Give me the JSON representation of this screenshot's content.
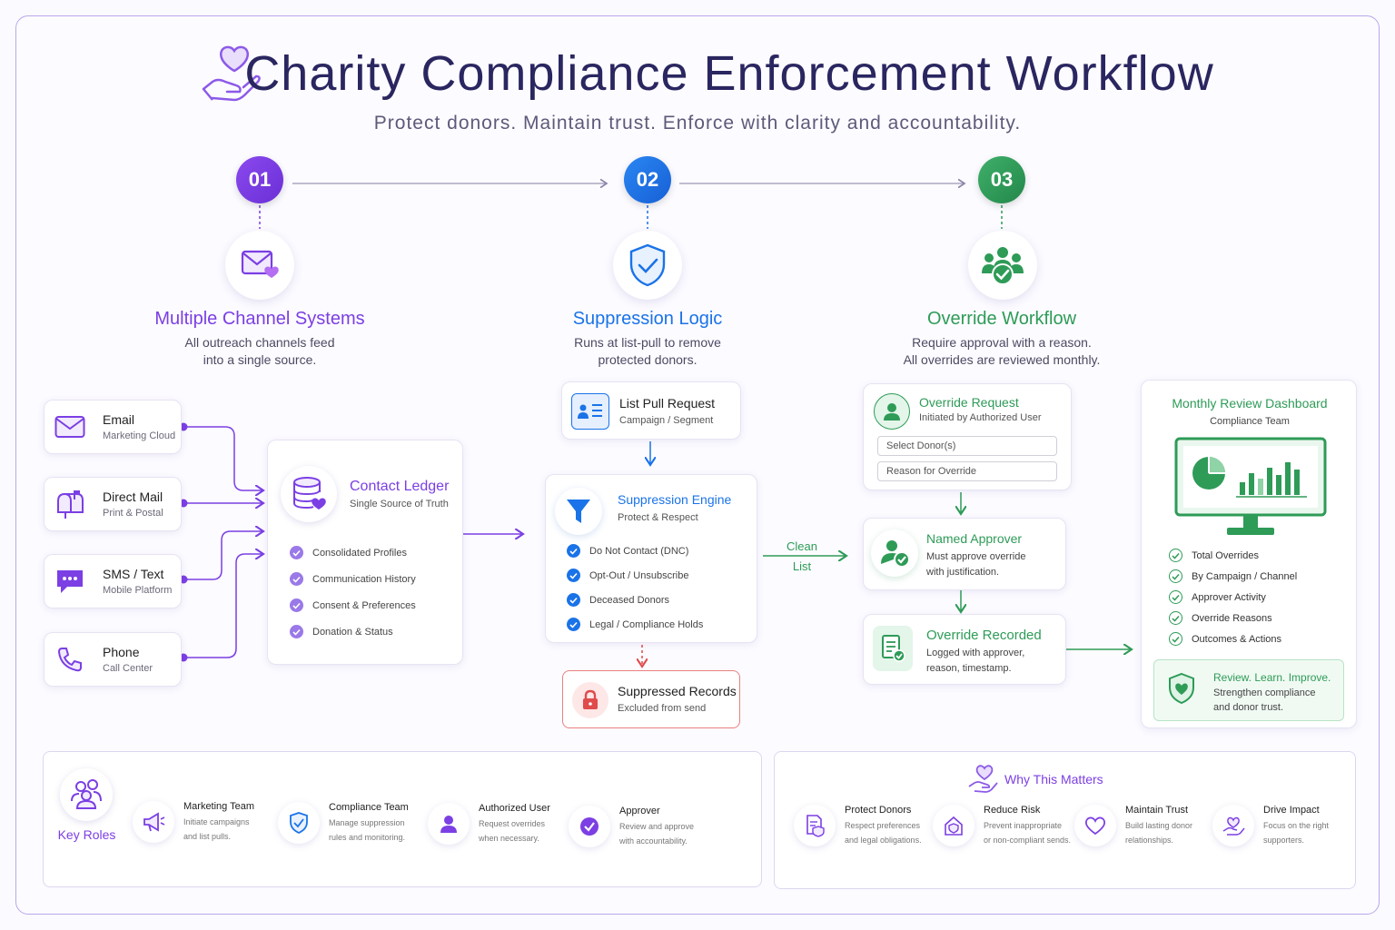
{
  "header": {
    "title": "Charity Compliance Enforcement Workflow",
    "subtitle": "Protect donors. Maintain trust. Enforce with clarity and accountability."
  },
  "colors": {
    "purple": "#7b3fe4",
    "blue": "#1a73e8",
    "green": "#2e9b57",
    "red": "#e04b4b"
  },
  "steps": [
    {
      "num": "01",
      "title": "Multiple Channel Systems",
      "desc_line1": "All outreach channels feed",
      "desc_line2": "into a single source.",
      "icon": "mail-heart-icon"
    },
    {
      "num": "02",
      "title": "Suppression Logic",
      "desc_line1": "Runs at list-pull to remove",
      "desc_line2": "protected donors.",
      "icon": "shield-check-icon"
    },
    {
      "num": "03",
      "title": "Override Workflow",
      "desc_line1": "Require approval with a reason.",
      "desc_line2": "All overrides are reviewed monthly.",
      "icon": "team-check-icon"
    }
  ],
  "channels": [
    {
      "title": "Email",
      "sub": "Marketing Cloud",
      "icon": "envelope-icon"
    },
    {
      "title": "Direct Mail",
      "sub": "Print & Postal",
      "icon": "mailbox-icon"
    },
    {
      "title": "SMS / Text",
      "sub": "Mobile Platform",
      "icon": "chat-icon"
    },
    {
      "title": "Phone",
      "sub": "Call Center",
      "icon": "phone-icon"
    }
  ],
  "ledger": {
    "title": "Contact Ledger",
    "sub": "Single Source of Truth",
    "items": [
      "Consolidated Profiles",
      "Communication History",
      "Consent & Preferences",
      "Donation & Status"
    ]
  },
  "list_pull": {
    "title": "List Pull Request",
    "sub": "Campaign / Segment"
  },
  "engine": {
    "title": "Suppression Engine",
    "sub": "Protect & Respect",
    "items": [
      "Do Not Contact (DNC)",
      "Opt-Out / Unsubscribe",
      "Deceased Donors",
      "Legal / Compliance Holds"
    ]
  },
  "suppressed": {
    "title": "Suppressed Records",
    "sub": "Excluded from send"
  },
  "clean_list": {
    "line1": "Clean",
    "line2": "List"
  },
  "override_request": {
    "title": "Override Request",
    "sub": "Initiated by Authorized User",
    "field1": "Select Donor(s)",
    "field2": "Reason for Override"
  },
  "named_approver": {
    "title": "Named Approver",
    "line1": "Must approve override",
    "line2": "with justification."
  },
  "override_recorded": {
    "title": "Override Recorded",
    "line1": "Logged with approver,",
    "line2": "reason, timestamp."
  },
  "dashboard": {
    "title": "Monthly Review Dashboard",
    "sub": "Compliance Team",
    "items": [
      "Total Overrides",
      "By Campaign / Channel",
      "Approver Activity",
      "Override Reasons",
      "Outcomes & Actions"
    ],
    "callout_title": "Review. Learn. Improve.",
    "callout_line1": "Strengthen compliance",
    "callout_line2": "and donor trust."
  },
  "roles": {
    "label": "Key Roles",
    "items": [
      {
        "title": "Marketing Team",
        "line1": "Initiate campaigns",
        "line2": "and list pulls.",
        "icon": "megaphone-icon"
      },
      {
        "title": "Compliance Team",
        "line1": "Manage suppression",
        "line2": "rules and monitoring.",
        "icon": "shield-icon"
      },
      {
        "title": "Authorized User",
        "line1": "Request overrides",
        "line2": "when necessary.",
        "icon": "user-icon"
      },
      {
        "title": "Approver",
        "line1": "Review and approve",
        "line2": "with accountability.",
        "icon": "check-badge-icon"
      }
    ]
  },
  "why": {
    "title": "Why This Matters",
    "items": [
      {
        "title": "Protect Donors",
        "line1": "Respect preferences",
        "line2": "and legal obligations.",
        "icon": "document-shield-icon"
      },
      {
        "title": "Reduce Risk",
        "line1": "Prevent inappropriate",
        "line2": "or non-compliant sends.",
        "icon": "house-shield-icon"
      },
      {
        "title": "Maintain Trust",
        "line1": "Build lasting donor",
        "line2": "relationships.",
        "icon": "heart-icon"
      },
      {
        "title": "Drive Impact",
        "line1": "Focus on the right",
        "line2": "supporters.",
        "icon": "hand-heart-icon"
      }
    ]
  }
}
